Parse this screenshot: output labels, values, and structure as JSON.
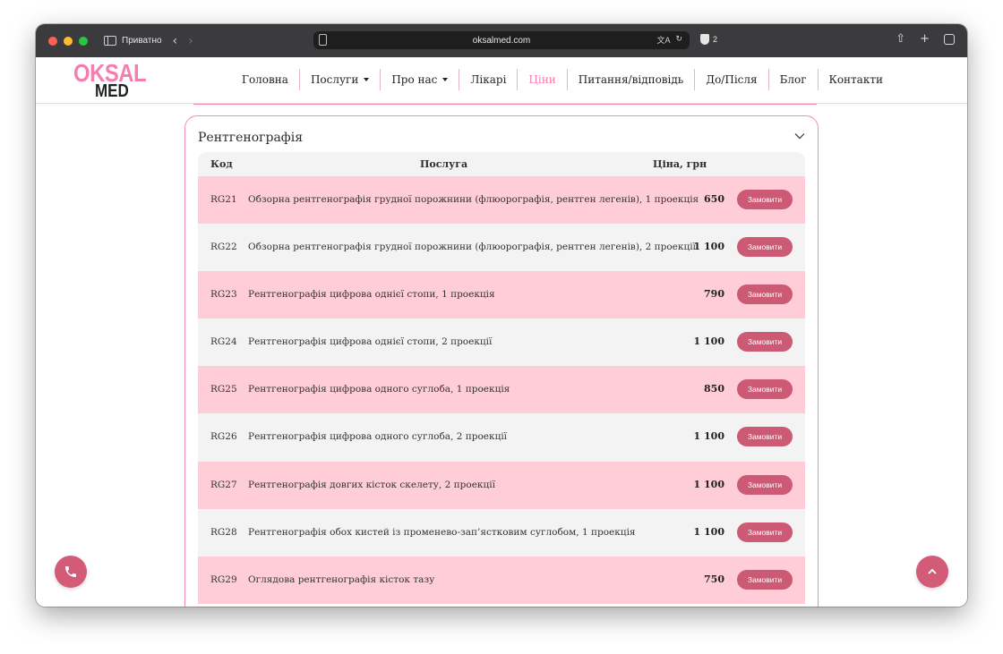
{
  "browser": {
    "private_label": "Приватно",
    "url": "oksalmed.com",
    "shield_count": "2",
    "icons": [
      "sidebar-icon",
      "back-icon",
      "forward-icon",
      "page-icon",
      "translate-icon",
      "reload-icon",
      "shield-icon",
      "share-icon",
      "new-tab-icon",
      "tabs-icon"
    ]
  },
  "site": {
    "logo_top": "OKSAL",
    "logo_bottom": "MED",
    "colors": {
      "brand_pink": "#f47fae",
      "button": "#cc5a75",
      "row_pink": "#ffcdd8",
      "row_grey": "#f3f3f3"
    },
    "menu": [
      {
        "label": "Головна",
        "dropdown": false,
        "active": false
      },
      {
        "label": "Послуги",
        "dropdown": true,
        "active": false
      },
      {
        "label": "Про нас",
        "dropdown": true,
        "active": false
      },
      {
        "label": "Лікарі",
        "dropdown": false,
        "active": false
      },
      {
        "label": "Ціни",
        "dropdown": false,
        "active": true
      },
      {
        "label": "Питання/відповідь",
        "dropdown": false,
        "active": false
      },
      {
        "label": "До/Після",
        "dropdown": false,
        "active": false
      },
      {
        "label": "Блог",
        "dropdown": false,
        "active": false
      },
      {
        "label": "Контакти",
        "dropdown": false,
        "active": false
      }
    ]
  },
  "section": {
    "title": "Рентгенографія",
    "headers": {
      "code": "Код",
      "service": "Послуга",
      "price": "Ціна, грн"
    },
    "order_label": "Замовити",
    "rows": [
      {
        "code": "RG21",
        "name": "Обзорна рентгенографія грудної порожнини (флюорографія, рентген легенів), 1 проекція",
        "price": "650"
      },
      {
        "code": "RG22",
        "name": "Обзорна рентгенографія грудної порожнини (флюорографія, рентген легенів), 2 проекції",
        "price": "1 100"
      },
      {
        "code": "RG23",
        "name": "Рентгенографія цифрова однієї стопи, 1 проекція",
        "price": "790"
      },
      {
        "code": "RG24",
        "name": "Рентгенографія цифрова однієї стопи, 2 проекції",
        "price": "1 100"
      },
      {
        "code": "RG25",
        "name": "Рентгенографія цифрова одного суглоба, 1 проекція",
        "price": "850"
      },
      {
        "code": "RG26",
        "name": "Рентгенографія цифрова одного суглоба, 2 проекції",
        "price": "1 100"
      },
      {
        "code": "RG27",
        "name": "Рентгенографія довгих кісток скелету, 2 проекції",
        "price": "1 100"
      },
      {
        "code": "RG28",
        "name": "Рентгенографія обох кистей із променево-зап’ястковим суглобом, 1 проекція",
        "price": "1 100"
      },
      {
        "code": "RG29",
        "name": "Оглядова рентгенографія кісток тазу",
        "price": "750"
      }
    ]
  },
  "floating": {
    "left_icon": "phone-icon",
    "right_icon": "scroll-up-icon"
  }
}
